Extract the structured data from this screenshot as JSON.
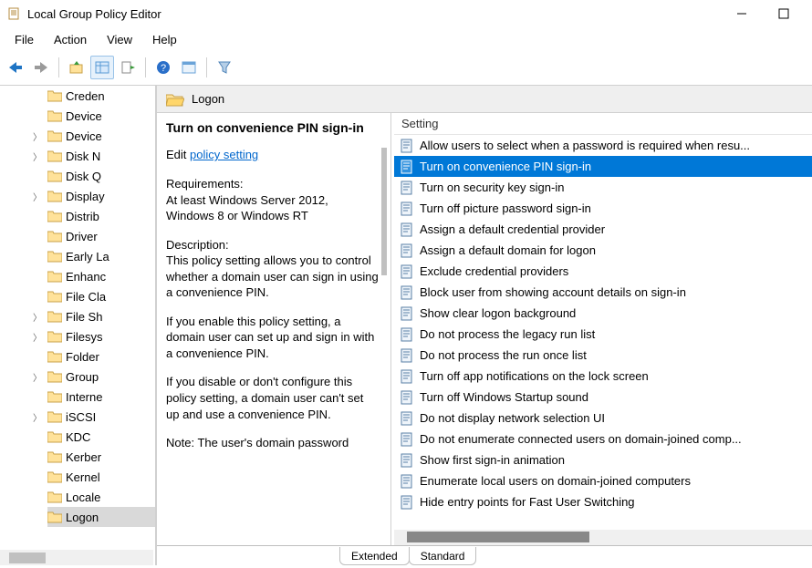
{
  "window": {
    "title": "Local Group Policy Editor"
  },
  "menu": {
    "file": "File",
    "action": "Action",
    "view": "View",
    "help": "Help"
  },
  "tree": {
    "items": [
      {
        "label": "Creden",
        "expandable": false
      },
      {
        "label": "Device",
        "expandable": false
      },
      {
        "label": "Device",
        "expandable": true
      },
      {
        "label": "Disk N",
        "expandable": true
      },
      {
        "label": "Disk Q",
        "expandable": false
      },
      {
        "label": "Display",
        "expandable": true
      },
      {
        "label": "Distrib",
        "expandable": false
      },
      {
        "label": "Driver",
        "expandable": false
      },
      {
        "label": "Early La",
        "expandable": false
      },
      {
        "label": "Enhanc",
        "expandable": false
      },
      {
        "label": "File Cla",
        "expandable": false
      },
      {
        "label": "File Sh",
        "expandable": true
      },
      {
        "label": "Filesys",
        "expandable": true
      },
      {
        "label": "Folder",
        "expandable": false
      },
      {
        "label": "Group",
        "expandable": true
      },
      {
        "label": "Interne",
        "expandable": false
      },
      {
        "label": "iSCSI",
        "expandable": true
      },
      {
        "label": "KDC",
        "expandable": false
      },
      {
        "label": "Kerber",
        "expandable": false
      },
      {
        "label": "Kernel",
        "expandable": false
      },
      {
        "label": "Locale",
        "expandable": false
      },
      {
        "label": "Logon",
        "expandable": false,
        "selected": true
      }
    ]
  },
  "right_header": "Logon",
  "desc": {
    "title": "Turn on convenience PIN sign-in",
    "edit_prefix": "Edit ",
    "edit_link": "policy setting",
    "req_label": "Requirements:",
    "req_text": "At least Windows Server 2012, Windows 8 or Windows RT",
    "desc_label": "Description:",
    "para1": "This policy setting allows you to control whether a domain user can sign in using a convenience PIN.",
    "para2": "If you enable this policy setting, a domain user can set up and sign in with a convenience PIN.",
    "para3": "If you disable or don't configure this policy setting, a domain user can't set up and use a convenience PIN.",
    "para4": "Note: The user's domain password"
  },
  "list": {
    "header": "Setting",
    "items": [
      "Allow users to select when a password is required when resu...",
      "Turn on convenience PIN sign-in",
      "Turn on security key sign-in",
      "Turn off picture password sign-in",
      "Assign a default credential provider",
      "Assign a default domain for logon",
      "Exclude credential providers",
      "Block user from showing account details on sign-in",
      "Show clear logon background",
      "Do not process the legacy run list",
      "Do not process the run once list",
      "Turn off app notifications on the lock screen",
      "Turn off Windows Startup sound",
      "Do not display network selection UI",
      "Do not enumerate connected users on domain-joined comp...",
      "Show first sign-in animation",
      "Enumerate local users on domain-joined computers",
      "Hide entry points for Fast User Switching"
    ],
    "selected_index": 1
  },
  "tabs": {
    "extended": "Extended",
    "standard": "Standard"
  }
}
